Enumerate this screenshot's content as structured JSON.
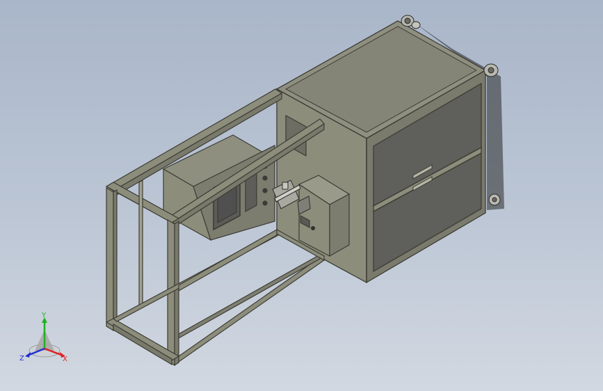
{
  "triad": {
    "x_label": "X",
    "y_label": "Y",
    "z_label": "Z",
    "x_color": "#e02020",
    "y_color": "#20b020",
    "z_color": "#2030d0"
  },
  "colors": {
    "frame_fill": "#8d8d7c",
    "frame_edge": "#3c3c34",
    "panel_light": "#9e9e8c",
    "panel_dark": "#65655d",
    "drawer": "#5f5f5b"
  }
}
